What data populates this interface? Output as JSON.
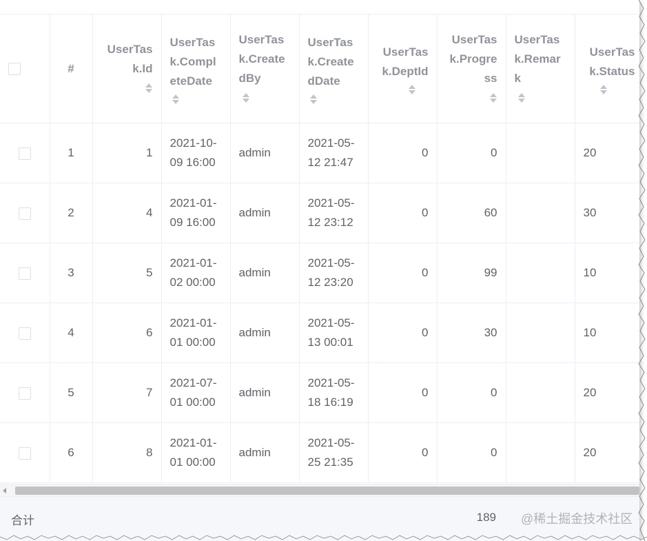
{
  "columns": [
    {
      "label": "",
      "sortable": false
    },
    {
      "label": "#",
      "sortable": false
    },
    {
      "label": "UserTask.Id",
      "sortable": true
    },
    {
      "label": "UserTask.CompleteDate",
      "sortable": true
    },
    {
      "label": "UserTask.CreatedBy",
      "sortable": true
    },
    {
      "label": "UserTask.CreatedDate",
      "sortable": true
    },
    {
      "label": "UserTask.DeptId",
      "sortable": true
    },
    {
      "label": "UserTask.Progress",
      "sortable": true
    },
    {
      "label": "UserTask.Remark",
      "sortable": true
    },
    {
      "label": "UserTask.Status",
      "sortable": true
    }
  ],
  "rows": [
    {
      "index": "1",
      "id": "1",
      "complete_date": "2021-10-09 16:00",
      "created_by": "admin",
      "created_date": "2021-05-12 21:47",
      "dept_id": "0",
      "progress": "0",
      "remark": "",
      "status": "20"
    },
    {
      "index": "2",
      "id": "4",
      "complete_date": "2021-01-09 16:00",
      "created_by": "admin",
      "created_date": "2021-05-12 23:12",
      "dept_id": "0",
      "progress": "60",
      "remark": "",
      "status": "30"
    },
    {
      "index": "3",
      "id": "5",
      "complete_date": "2021-01-02 00:00",
      "created_by": "admin",
      "created_date": "2021-05-12 23:20",
      "dept_id": "0",
      "progress": "99",
      "remark": "",
      "status": "10"
    },
    {
      "index": "4",
      "id": "6",
      "complete_date": "2021-01-01 00:00",
      "created_by": "admin",
      "created_date": "2021-05-13 00:01",
      "dept_id": "0",
      "progress": "30",
      "remark": "",
      "status": "10"
    },
    {
      "index": "5",
      "id": "7",
      "complete_date": "2021-07-01 00:00",
      "created_by": "admin",
      "created_date": "2021-05-18 16:19",
      "dept_id": "0",
      "progress": "0",
      "remark": "",
      "status": "20"
    },
    {
      "index": "6",
      "id": "8",
      "complete_date": "2021-01-01 00:00",
      "created_by": "admin",
      "created_date": "2021-05-25 21:35",
      "dept_id": "0",
      "progress": "0",
      "remark": "",
      "status": "20"
    }
  ],
  "footer": {
    "label": "合计",
    "progress_sum": "189"
  },
  "watermark": "@稀土掘金技术社区",
  "colors": {
    "border": "#ebeef5",
    "header_text": "#909399",
    "cell_text": "#606266",
    "footer_bg": "#f5f7fa",
    "scroll_thumb": "#c1c1c1"
  }
}
